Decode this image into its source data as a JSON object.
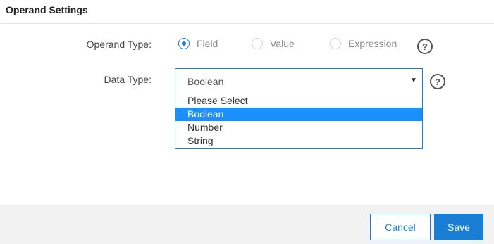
{
  "header": {
    "title": "Operand Settings"
  },
  "operand_type": {
    "label": "Operand Type:",
    "options": [
      {
        "label": "Field",
        "checked": true
      },
      {
        "label": "Value",
        "checked": false
      },
      {
        "label": "Expression",
        "checked": false
      }
    ],
    "help_glyph": "?"
  },
  "data_type": {
    "label": "Data Type:",
    "selected": "Boolean",
    "caret": "▼",
    "options": [
      "Please Select",
      "Boolean",
      "Number",
      "String"
    ],
    "help_glyph": "?"
  },
  "footer": {
    "cancel_label": "Cancel",
    "save_label": "Save"
  },
  "colors": {
    "accent": "#1a7fd4",
    "selected_option_bg": "#1a90ff",
    "footer_bg": "#f2f2f2"
  }
}
